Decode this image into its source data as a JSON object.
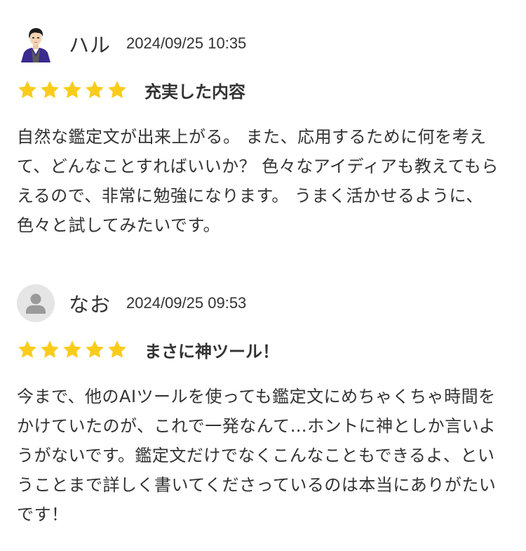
{
  "reviews": [
    {
      "username": "ハル",
      "timestamp": "2024/09/25 10:35",
      "rating": 5,
      "max_rating": 5,
      "title": "充実した内容",
      "body": "自然な鑑定文が出来上がる。 また、応用するために何を考えて、どんなことすればいいか？ 色々なアイディアも教えてもらえるので、非常に勉強になります。 うまく活かせるように、色々と試してみたいです。",
      "avatar": "user-photo-avatar"
    },
    {
      "username": "なお",
      "timestamp": "2024/09/25 09:53",
      "rating": 5,
      "max_rating": 5,
      "title": "まさに神ツール！",
      "body": "今まで、他のAIツールを使っても鑑定文にめちゃくちゃ時間をかけていたのが、これで一発なんて…ホントに神としか言いようがないです。鑑定文だけでなくこんなこともできるよ、ということまで詳しく書いてくださっているのは本当にありがたいです！",
      "avatar": "default-user-icon"
    }
  ],
  "colors": {
    "star": "#f9cc1c",
    "text": "#333333",
    "default_avatar_bg": "#e5e5e5",
    "default_avatar_fg": "#9a9a9a"
  }
}
